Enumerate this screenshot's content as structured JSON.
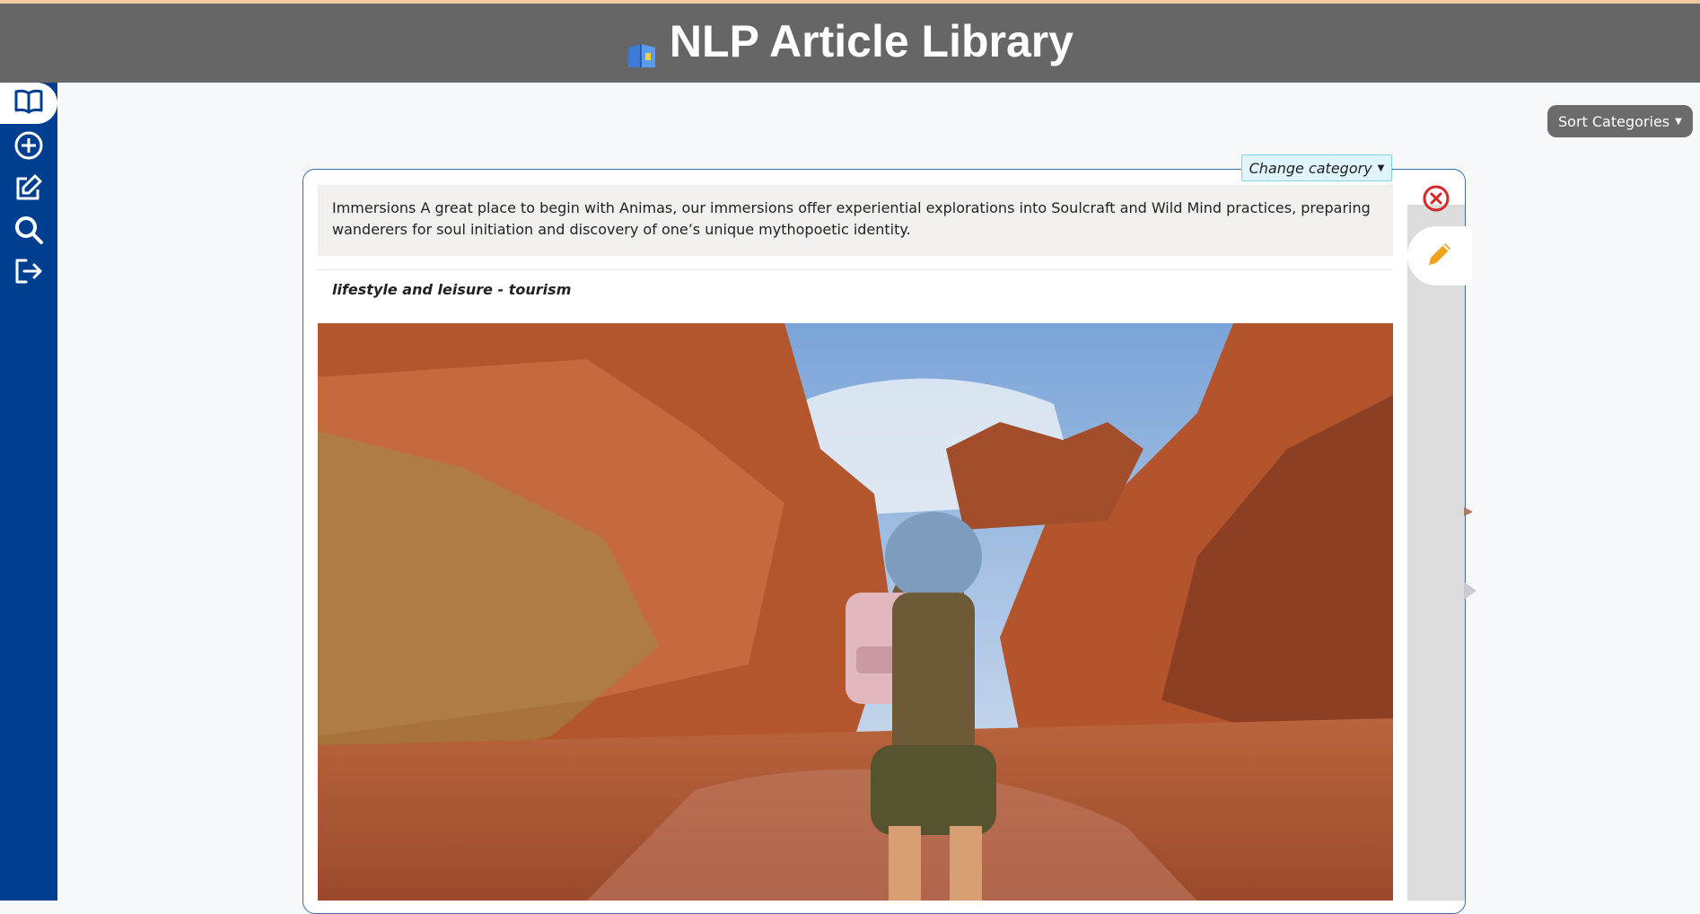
{
  "header": {
    "title": "NLP Article Library",
    "logo_icon": "book-icon"
  },
  "sidebar": {
    "items": [
      {
        "name": "library",
        "icon": "open-book-icon",
        "active": true
      },
      {
        "name": "add-article",
        "icon": "plus-circle-icon",
        "active": false
      },
      {
        "name": "edit",
        "icon": "edit-icon",
        "active": false
      },
      {
        "name": "search",
        "icon": "search-icon",
        "active": false
      },
      {
        "name": "logout",
        "icon": "logout-icon",
        "active": false
      }
    ]
  },
  "toolbar": {
    "sort_label": "Sort Categories"
  },
  "article": {
    "change_category_label": "Change category",
    "summary": "Immersions A great place to begin with Animas, our immersions offer experiential explorations into Soulcraft and Wild Mind practices, preparing wanderers for soul initiation and discovery of one’s unique mythopoetic identity.",
    "category": "lifestyle and leisure - tourism",
    "image_icon": "photo"
  },
  "colors": {
    "header_bg": "#666666",
    "sidebar_bg": "#003f8f",
    "card_border": "#3a6fa8",
    "close_red": "#d62828",
    "edit_orange": "#f0a21c"
  }
}
